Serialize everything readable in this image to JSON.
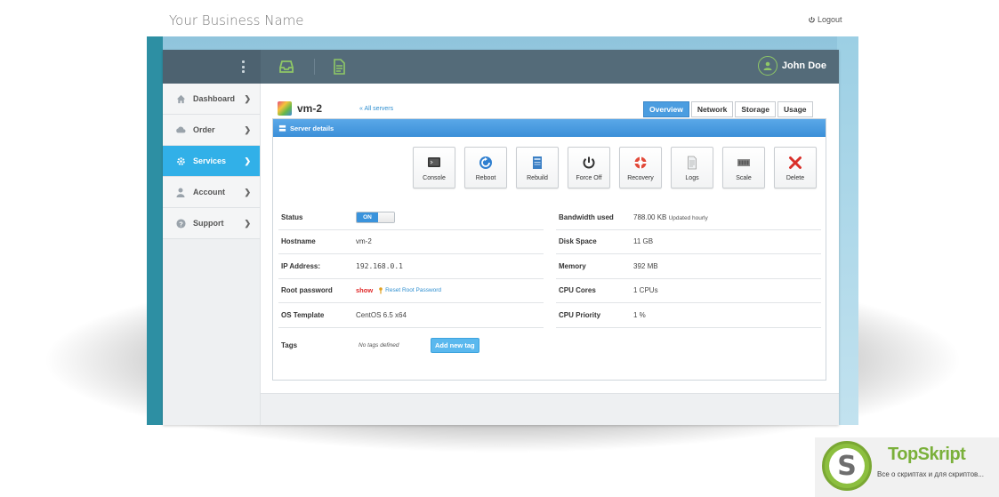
{
  "brand": {
    "name": "Your Business Name",
    "logout_label": "Logout"
  },
  "header": {
    "user_name": "John Doe"
  },
  "sidebar": {
    "items": [
      {
        "label": "Dashboard",
        "icon": "home-icon",
        "active": false
      },
      {
        "label": "Order",
        "icon": "cloud-icon",
        "active": false
      },
      {
        "label": "Services",
        "icon": "gear-icon",
        "active": true
      },
      {
        "label": "Account",
        "icon": "user-icon",
        "active": false
      },
      {
        "label": "Support",
        "icon": "help-icon",
        "active": false
      }
    ]
  },
  "server": {
    "name": "vm-2",
    "all_servers_link": "« All servers"
  },
  "tabs": [
    {
      "label": "Overview",
      "active": true
    },
    {
      "label": "Network",
      "active": false
    },
    {
      "label": "Storage",
      "active": false
    },
    {
      "label": "Usage",
      "active": false
    }
  ],
  "panel": {
    "title": "Server details"
  },
  "actions": [
    {
      "label": "Console",
      "icon": "console-icon"
    },
    {
      "label": "Reboot",
      "icon": "reboot-icon"
    },
    {
      "label": "Rebuild",
      "icon": "rebuild-icon"
    },
    {
      "label": "Force Off",
      "icon": "power-icon"
    },
    {
      "label": "Recovery",
      "icon": "lifebuoy-icon"
    },
    {
      "label": "Logs",
      "icon": "document-icon"
    },
    {
      "label": "Scale",
      "icon": "memory-icon"
    },
    {
      "label": "Delete",
      "icon": "delete-x-icon"
    }
  ],
  "details_left": {
    "status_label": "Status",
    "status_toggle": "ON",
    "hostname_label": "Hostname",
    "hostname_value": "vm-2",
    "ip_label": "IP Address:",
    "ip_value": "192.168.0.1",
    "root_label": "Root password",
    "root_show": "show",
    "root_reset": "Reset Root Password",
    "os_label": "OS Template",
    "os_value": "CentOS 6.5 x64"
  },
  "details_right": {
    "bandwidth_label": "Bandwidth used",
    "bandwidth_value": "788.00 KB",
    "bandwidth_note": "Updated hourly",
    "disk_label": "Disk Space",
    "disk_value": "11 GB",
    "memory_label": "Memory",
    "memory_value": "392 MB",
    "cores_label": "CPU Cores",
    "cores_value": "1 CPUs",
    "priority_label": "CPU Priority",
    "priority_value": "1 %"
  },
  "tags": {
    "label": "Tags",
    "empty_text": "No tags defined",
    "add_button": "Add new tag"
  },
  "watermark": {
    "letter": "S",
    "name": "TopSkript",
    "subtitle": "Все о скриптах и для скриптов..."
  },
  "colors": {
    "accent": "#31b0e8",
    "header": "#546b79",
    "header_icon": "#8fc866",
    "danger": "#e02828"
  }
}
